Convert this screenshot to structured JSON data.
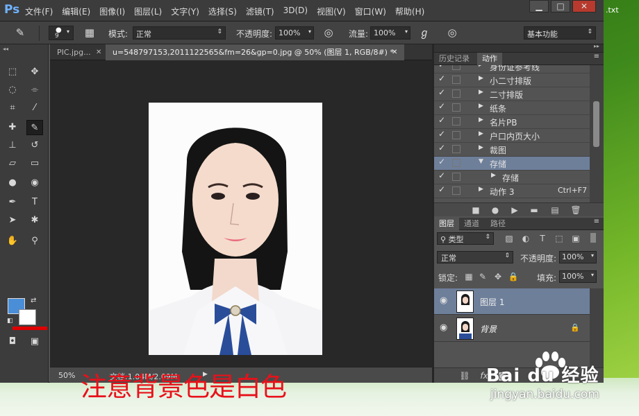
{
  "desktop": {
    "file_label": ".txt"
  },
  "app": {
    "logo": "Ps"
  },
  "menu": [
    "文件(F)",
    "编辑(E)",
    "图像(I)",
    "图层(L)",
    "文字(Y)",
    "选择(S)",
    "滤镜(T)",
    "3D(D)",
    "视图(V)",
    "窗口(W)",
    "帮助(H)"
  ],
  "window_controls": {
    "minimize": "▁",
    "maximize": "□",
    "close": "✕"
  },
  "options": {
    "brush_size": "9",
    "mode_label": "模式:",
    "mode_value": "正常",
    "opacity_label": "不透明度:",
    "opacity_value": "100%",
    "flow_label": "流量:",
    "flow_value": "100%",
    "workspace": "基本功能"
  },
  "tabs": [
    {
      "label": "PIC.jpg..."
    },
    {
      "label": "u=548797153,2011122565&fm=26&gp=0.jpg @ 50% (图层 1, RGB/8#) *"
    }
  ],
  "colors": {
    "foreground": "#4a8ed8",
    "background": "#ffffff",
    "annotation": "#e8111a",
    "accent": "#6e7f9a"
  },
  "annotation_text": "注意背景色是白色",
  "status": {
    "zoom": "50%",
    "doc_size": "文档:1.04M/2.09M"
  },
  "history_panel": {
    "tabs": [
      "历史记录",
      "动作"
    ],
    "actions": [
      {
        "name": "身份证参考线",
        "shortcut": ""
      },
      {
        "name": "小二寸排版",
        "shortcut": ""
      },
      {
        "name": "二寸排版",
        "shortcut": ""
      },
      {
        "name": "纸条",
        "shortcut": ""
      },
      {
        "name": "名片PB",
        "shortcut": ""
      },
      {
        "name": "户口内页大小",
        "shortcut": ""
      },
      {
        "name": "裁图",
        "shortcut": ""
      },
      {
        "name": "存储",
        "shortcut": "",
        "expanded": true,
        "selected": true
      },
      {
        "name": "存储",
        "shortcut": "",
        "child": true
      },
      {
        "name": "动作 3",
        "shortcut": "Ctrl+F7"
      }
    ]
  },
  "layers_panel": {
    "tabs": [
      "图层",
      "通道",
      "路径"
    ],
    "filter_label": "类型",
    "blend_mode": "正常",
    "opacity_label": "不透明度:",
    "opacity_value": "100%",
    "lock_label": "锁定:",
    "fill_label": "填充:",
    "fill_value": "100%",
    "layers": [
      {
        "name": "图层 1",
        "selected": true
      },
      {
        "name": "背景",
        "locked": true
      }
    ]
  },
  "watermark": {
    "brand": "Bai du 经验",
    "url": "jingyan.baidu.com"
  }
}
